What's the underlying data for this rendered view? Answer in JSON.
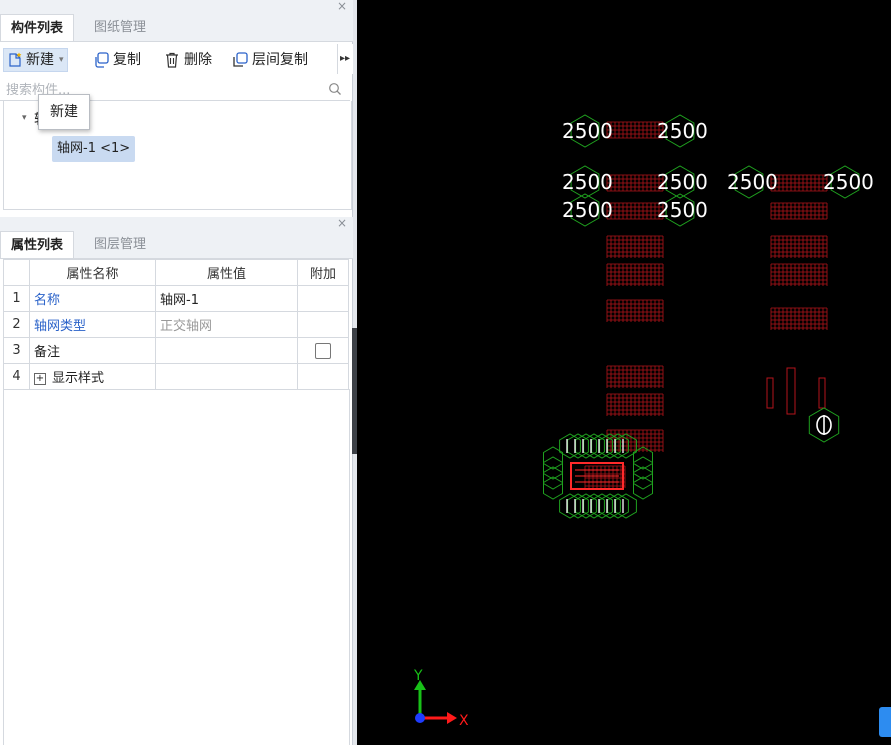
{
  "component_panel": {
    "close_glyph": "×",
    "tabs": [
      {
        "label": "构件列表",
        "active": true
      },
      {
        "label": "图纸管理",
        "active": false
      }
    ],
    "toolbar": {
      "new_label": "新建",
      "new_caret": "▾",
      "copy_label": "复制",
      "delete_label": "删除",
      "floor_copy_label": "层间复制",
      "more_glyph": "▸▸"
    },
    "search": {
      "placeholder": "搜索构件...",
      "value": ""
    },
    "tree": {
      "root_label": "轴网",
      "expander_glyph": "▾",
      "child_label": "轴网-1 <1>"
    },
    "tooltip": "新建"
  },
  "property_panel": {
    "close_glyph": "×",
    "tabs": [
      {
        "label": "属性列表",
        "active": true
      },
      {
        "label": "图层管理",
        "active": false
      }
    ],
    "headers": [
      "",
      "属性名称",
      "属性值",
      "附加"
    ],
    "rows": [
      {
        "num": "1",
        "name": "名称",
        "value": "轴网-1",
        "name_color": "blue",
        "value_color": "normal",
        "addon": "none"
      },
      {
        "num": "2",
        "name": "轴网类型",
        "value": "正交轴网",
        "name_color": "blue",
        "value_color": "gray",
        "addon": "none"
      },
      {
        "num": "3",
        "name": "备注",
        "value": "",
        "name_color": "normal",
        "value_color": "normal",
        "addon": "checkbox"
      },
      {
        "num": "4",
        "name": "显示样式",
        "value": "",
        "name_color": "normal",
        "value_color": "normal",
        "addon": "none",
        "expand_glyph": "+"
      }
    ]
  },
  "canvas": {
    "dimension_labels": [
      "2500",
      "2500",
      "2500",
      "2500",
      "2500",
      "2500",
      "2500",
      "2500"
    ],
    "axis_y_label": "Y",
    "axis_x_label": "X",
    "colors": {
      "background": "#000000",
      "grid": "#b5141b",
      "axis_circle": "#1fa01f",
      "text": "#ffffff",
      "axis_x": "#ff1a1a",
      "axis_y": "#18c018",
      "origin": "#1e3cff"
    }
  }
}
